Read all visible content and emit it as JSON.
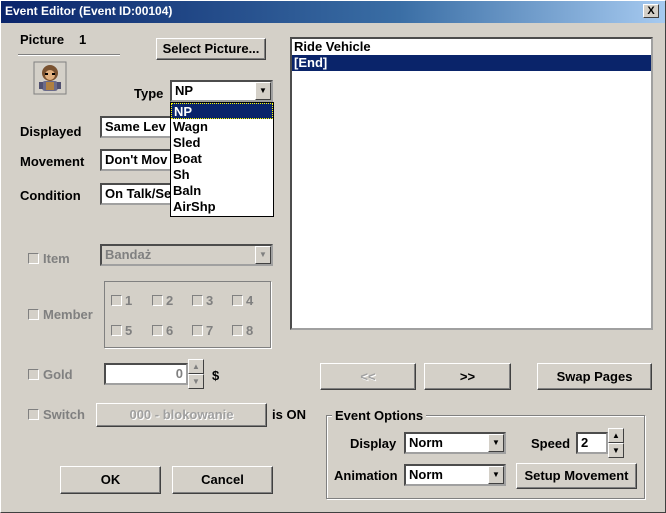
{
  "window": {
    "title": "Event Editor (Event ID:00104)",
    "close_glyph": "X"
  },
  "picture": {
    "label": "Picture",
    "number": "1",
    "select_button": "Select Picture..."
  },
  "type": {
    "label": "Type",
    "value": "NP",
    "options": [
      "NP",
      "Wagn",
      "Sled",
      "Boat",
      "Sh",
      "Baln",
      "AirShp"
    ]
  },
  "displayed": {
    "label": "Displayed",
    "value": "Same Lev"
  },
  "movement": {
    "label": "Movement",
    "value": "Don't Mov"
  },
  "condition": {
    "label": "Condition",
    "value": "On Talk/Se"
  },
  "item": {
    "label": "Item",
    "value": "Bandaż"
  },
  "member": {
    "label": "Member",
    "slots": [
      "1",
      "2",
      "3",
      "4",
      "5",
      "6",
      "7",
      "8"
    ]
  },
  "gold": {
    "label": "Gold",
    "value": "0",
    "unit": "$"
  },
  "switch": {
    "label": "Switch",
    "value": "000 - blokowanie",
    "suffix": "is ON"
  },
  "command_list": {
    "items": [
      "Ride Vehicle",
      "[End]"
    ],
    "selected_index": 1
  },
  "page_nav": {
    "prev": "<<",
    "next": ">>",
    "swap": "Swap Pages"
  },
  "event_options": {
    "legend": "Event Options",
    "display_label": "Display",
    "display_value": "Norm",
    "speed_label": "Speed",
    "speed_value": "2",
    "animation_label": "Animation",
    "animation_value": "Norm",
    "setup_movement": "Setup Movement"
  },
  "buttons": {
    "ok": "OK",
    "cancel": "Cancel"
  },
  "icons": {
    "dropdown_arrow": "▼",
    "spin_up": "▲",
    "spin_down": "▼",
    "sprite": "character-sprite-icon"
  }
}
